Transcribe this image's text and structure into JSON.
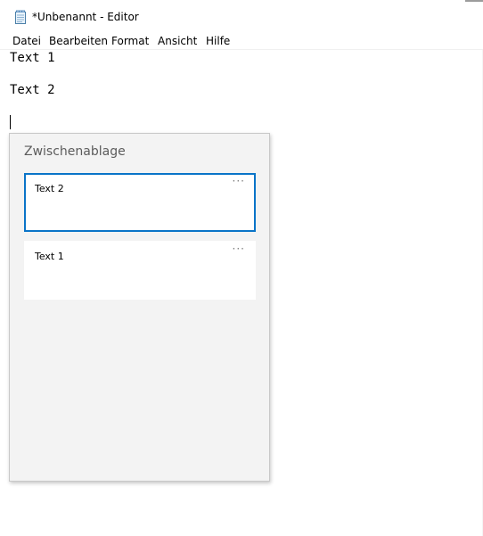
{
  "window": {
    "title": "*Unbenannt - Editor",
    "icon": "notepad-icon"
  },
  "menu": {
    "items": [
      {
        "label": "Datei"
      },
      {
        "label": "Bearbeiten"
      },
      {
        "label": "Format"
      },
      {
        "label": "Ansicht"
      },
      {
        "label": "Hilfe"
      }
    ]
  },
  "editor": {
    "lines": [
      "Text 1",
      "",
      "Text 2",
      ""
    ]
  },
  "clipboard": {
    "title": "Zwischenablage",
    "items": [
      {
        "text": "Text 2",
        "selected": true,
        "more_label": "···"
      },
      {
        "text": "Text 1",
        "selected": false,
        "more_label": "···"
      }
    ],
    "accent_color": "#0a74c8"
  }
}
